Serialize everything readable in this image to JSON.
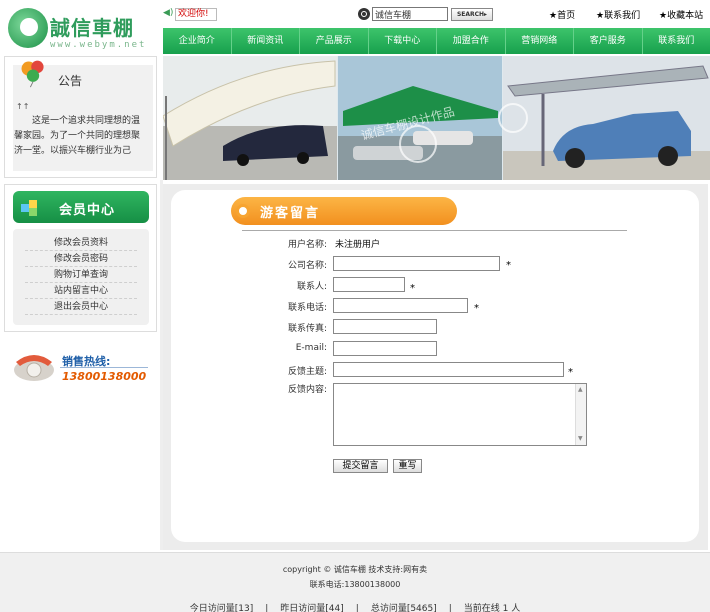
{
  "header": {
    "logo_text": "誠信車棚",
    "logo_url": "www.webym.net",
    "welcome": "欢迎你!",
    "search_value": "诚信车棚",
    "search_button": "SEARCH▸",
    "links": [
      "★首页",
      "★联系我们",
      "★收藏本站"
    ]
  },
  "nav": {
    "items": [
      "企业简介",
      "新闻资讯",
      "产品展示",
      "下载中心",
      "加盟合作",
      "营销网络",
      "客户服务",
      "联系我们"
    ]
  },
  "banner": {
    "watermark": "诚信车棚设计作品"
  },
  "notice": {
    "title": "公告",
    "mark": "↑↑",
    "text": "这是一个追求共同理想的温馨家园。为了一个共同的理想聚济一堂。以振兴车棚行业为己"
  },
  "member": {
    "title": "会员中心",
    "items": [
      "修改会员资料",
      "修改会员密码",
      "购物订单查询",
      "站内留言中心",
      "退出会员中心"
    ]
  },
  "hotline": {
    "label": "销售热线:",
    "number": "13800138000"
  },
  "form": {
    "heading": "游客留言",
    "username_label": "用户名称:",
    "username_value": "未注册用户",
    "company_label": "公司名称:",
    "contact_label": "联系人:",
    "phone_label": "联系电话:",
    "fax_label": "联系传真:",
    "email_label": "E-mail:",
    "subject_label": "反馈主题:",
    "content_label": "反馈内容:",
    "required_mark": "*",
    "submit_label": "提交留言",
    "reset_label": "重写"
  },
  "footer": {
    "copyright": "copyright © 诚信车棚 技术支持:网有卖",
    "tel": "联系电话:13800138000",
    "today_visits": "今日访问量[13]",
    "yesterday_visits": "昨日访问量[44]",
    "total_visits": "总访问量[5465]",
    "online_now": "当前在线 1 人",
    "separator": "|"
  },
  "colors": {
    "brand_green": "#17a04d",
    "accent_orange": "#f2901f",
    "hotline_blue": "#1f5fa8",
    "welcome_red": "#d20000"
  }
}
